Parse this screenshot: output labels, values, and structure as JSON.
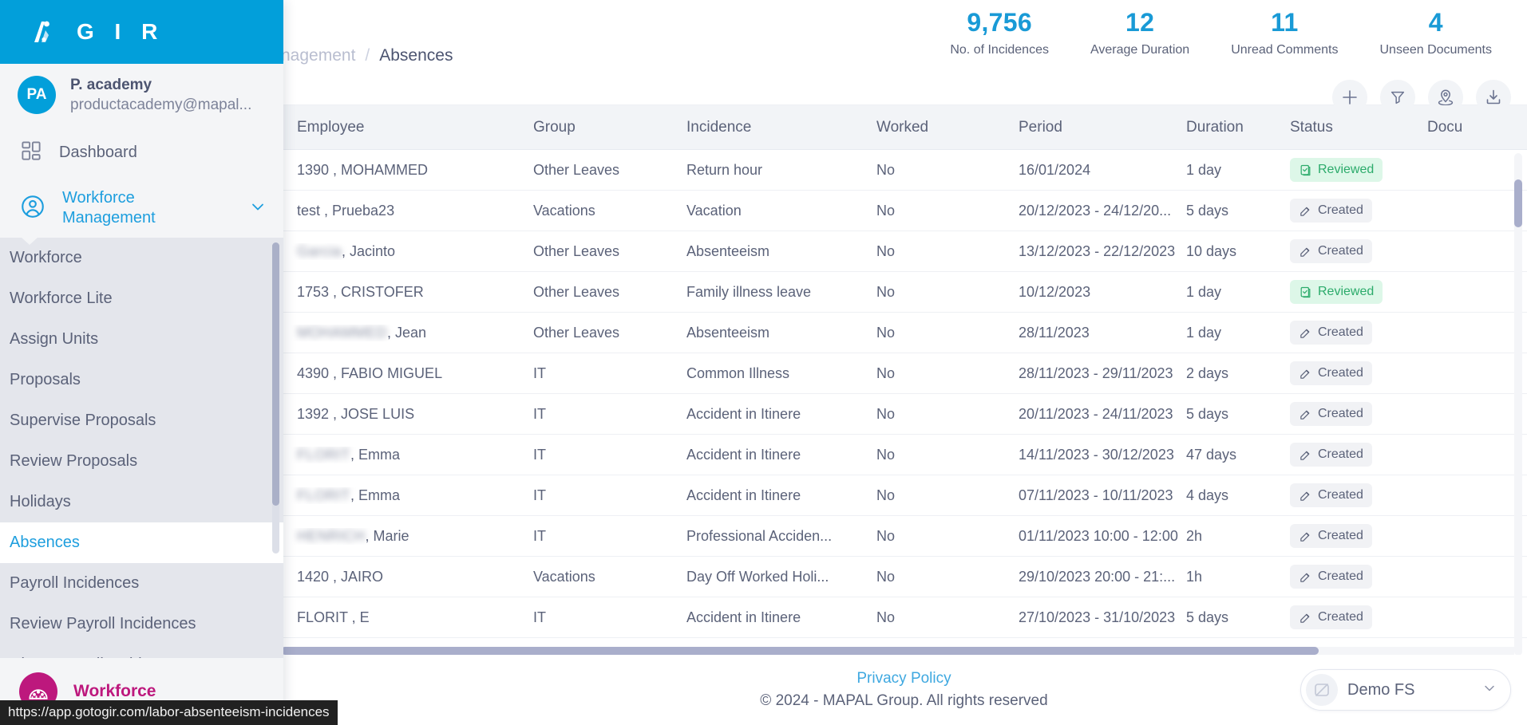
{
  "app": {
    "logo_text": "G I R",
    "logo_icon": "gir-logo-icon"
  },
  "sidebar": {
    "user": {
      "initials": "PA",
      "name": "P. academy",
      "email": "productacademy@mapal..."
    },
    "links": [
      {
        "label": "Dashboard",
        "icon": "grid-icon"
      }
    ],
    "group": {
      "label": "Workforce Management",
      "icon": "user-circle-icon",
      "chevron": "chevron-down-icon",
      "expanded": true
    },
    "sub_items": [
      {
        "label": "Workforce",
        "active": false
      },
      {
        "label": "Workforce Lite",
        "active": false
      },
      {
        "label": "Assign Units",
        "active": false
      },
      {
        "label": "Proposals",
        "active": false
      },
      {
        "label": "Supervise Proposals",
        "active": false
      },
      {
        "label": "Review Proposals",
        "active": false
      },
      {
        "label": "Holidays",
        "active": false
      },
      {
        "label": "Absences",
        "active": true
      },
      {
        "label": "Payroll Incidences",
        "active": false
      },
      {
        "label": "Review Payroll Incidences",
        "active": false
      },
      {
        "label": "Close Payroll Incidences",
        "active": false
      }
    ],
    "footer": {
      "label": "Workforce",
      "icon": "workforce-logo-icon",
      "color": "#bd187d"
    }
  },
  "breadcrumb": {
    "parent": "nagement",
    "separator": "/",
    "current": "Absences"
  },
  "kpis": [
    {
      "value": "9,756",
      "label": "No. of Incidences"
    },
    {
      "value": "12",
      "label": "Average Duration"
    },
    {
      "value": "11",
      "label": "Unread Comments"
    },
    {
      "value": "4",
      "label": "Unseen Documents"
    }
  ],
  "toolbar": [
    {
      "name": "add-button",
      "icon": "plus-icon"
    },
    {
      "name": "filter-button",
      "icon": "funnel-icon"
    },
    {
      "name": "location-button",
      "icon": "map-pin-icon"
    },
    {
      "name": "download-button",
      "icon": "download-icon"
    }
  ],
  "table": {
    "columns": [
      {
        "key": "employee",
        "label": "Employee"
      },
      {
        "key": "group",
        "label": "Group"
      },
      {
        "key": "incidence",
        "label": "Incidence"
      },
      {
        "key": "worked",
        "label": "Worked"
      },
      {
        "key": "period",
        "label": "Period"
      },
      {
        "key": "duration",
        "label": "Duration"
      },
      {
        "key": "status",
        "label": "Status"
      },
      {
        "key": "documents",
        "label": "Docu"
      }
    ],
    "rows": [
      {
        "employee": "1390 , MOHAMMED",
        "employee_redacted": "",
        "group": "Other Leaves",
        "incidence": "Return hour",
        "worked": "No",
        "period": "16/01/2024",
        "duration": "1 day",
        "status": "Reviewed",
        "status_kind": "reviewed"
      },
      {
        "employee": "test , Prueba23",
        "employee_redacted": "",
        "group": "Vacations",
        "incidence": "Vacation",
        "worked": "No",
        "period": "20/12/2023 - 24/12/20...",
        "duration": "5 days",
        "status": "Created",
        "status_kind": "created"
      },
      {
        "employee": ", Jacinto",
        "employee_redacted": "Garcia",
        "group": "Other Leaves",
        "incidence": "Absenteeism",
        "worked": "No",
        "period": "13/12/2023 - 22/12/2023",
        "duration": "10 days",
        "status": "Created",
        "status_kind": "created"
      },
      {
        "employee": "1753 , CRISTOFER",
        "employee_redacted": "",
        "group": "Other Leaves",
        "incidence": "Family illness leave",
        "worked": "No",
        "period": "10/12/2023",
        "duration": "1 day",
        "status": "Reviewed",
        "status_kind": "reviewed"
      },
      {
        "employee": ", Jean",
        "employee_redacted": "MOHAMMED",
        "group": "Other Leaves",
        "incidence": "Absenteeism",
        "worked": "No",
        "period": "28/11/2023",
        "duration": "1 day",
        "status": "Created",
        "status_kind": "created"
      },
      {
        "employee": "4390 , FABIO MIGUEL",
        "employee_redacted": "",
        "group": "IT",
        "incidence": "Common Illness",
        "worked": "No",
        "period": "28/11/2023 - 29/11/2023",
        "duration": "2 days",
        "status": "Created",
        "status_kind": "created"
      },
      {
        "employee": "1392 , JOSE LUIS",
        "employee_redacted": "",
        "group": "IT",
        "incidence": "Accident in Itinere",
        "worked": "No",
        "period": "20/11/2023 - 24/11/2023",
        "duration": "5 days",
        "status": "Created",
        "status_kind": "created"
      },
      {
        "employee": ", Emma",
        "employee_redacted": "FLORIT",
        "group": "IT",
        "incidence": "Accident in Itinere",
        "worked": "No",
        "period": "14/11/2023 - 30/12/2023",
        "duration": "47 days",
        "status": "Created",
        "status_kind": "created"
      },
      {
        "employee": ", Emma",
        "employee_redacted": "FLORIT",
        "group": "IT",
        "incidence": "Accident in Itinere",
        "worked": "No",
        "period": "07/11/2023 - 10/11/2023",
        "duration": "4 days",
        "status": "Created",
        "status_kind": "created"
      },
      {
        "employee": ", Marie",
        "employee_redacted": "HENRICH",
        "group": "IT",
        "incidence": "Professional Acciden...",
        "worked": "No",
        "period": "01/11/2023 10:00 - 12:00",
        "duration": "2h",
        "status": "Created",
        "status_kind": "created"
      },
      {
        "employee": "1420 , JAIRO",
        "employee_redacted": "",
        "group": "Vacations",
        "incidence": "Day Off Worked Holi...",
        "worked": "No",
        "period": "29/10/2023 20:00 - 21:...",
        "duration": "1h",
        "status": "Created",
        "status_kind": "created"
      },
      {
        "employee": "FLORIT , E",
        "employee_redacted": "",
        "group": "IT",
        "incidence": "Accident in Itinere",
        "worked": "No",
        "period": "27/10/2023 - 31/10/2023",
        "duration": "5 days",
        "status": "Created",
        "status_kind": "created"
      }
    ]
  },
  "footer": {
    "privacy_label": "Privacy Policy",
    "copyright": "© 2024 - MAPAL Group. All rights reserved",
    "fs_select": {
      "value": "Demo FS",
      "chevron": "chevron-down-icon",
      "avatar_icon": "store-icon"
    }
  },
  "status_bar": {
    "url": "https://app.gotogir.com/labor-absenteeism-incidences"
  },
  "colors": {
    "brand": "#029fda",
    "accent_pink": "#bd187d",
    "status_reviewed": "#2cab6b",
    "text": "#5b6279"
  }
}
